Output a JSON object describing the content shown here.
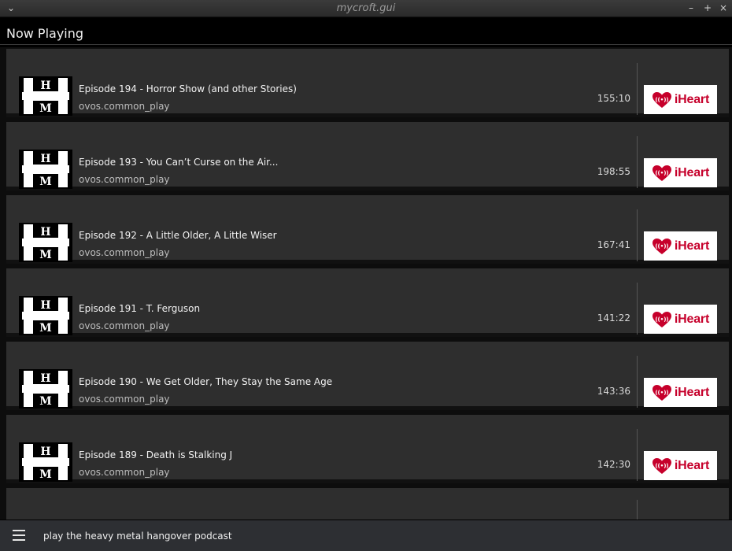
{
  "window": {
    "title": "mycroft.gui",
    "icons": [
      "chevron-down-icon",
      "minimize-icon",
      "maximize-icon",
      "close-icon"
    ]
  },
  "header": {
    "title": "Now Playing"
  },
  "episodes": [
    {
      "title": "Episode 194 - Horror Show (and other Stories)",
      "source": "ovos.common_play",
      "duration": "155:10",
      "provider": "iHeart"
    },
    {
      "title": "Episode 193 - You Can’t Curse on the Air...",
      "source": "ovos.common_play",
      "duration": "198:55",
      "provider": "iHeart"
    },
    {
      "title": "Episode 192 - A Little Older, A Little Wiser",
      "source": "ovos.common_play",
      "duration": "167:41",
      "provider": "iHeart"
    },
    {
      "title": "Episode 191 -   T. Ferguson",
      "source": "ovos.common_play",
      "duration": "141:22",
      "provider": "iHeart"
    },
    {
      "title": "Episode 190 - We Get Older, They Stay the Same Age",
      "source": "ovos.common_play",
      "duration": "143:36",
      "provider": "iHeart"
    },
    {
      "title": "Episode 189 - Death is Stalking J",
      "source": "ovos.common_play",
      "duration": "142:30",
      "provider": "iHeart"
    }
  ],
  "thumbnail": {
    "letters": [
      "H",
      "M"
    ]
  },
  "command_bar": {
    "query": "play the heavy metal hangover podcast",
    "menu_icon": "hamburger-menu-icon"
  },
  "colors": {
    "brand": "#c6002b",
    "card": "#2e2e2e",
    "background": "#000000"
  }
}
